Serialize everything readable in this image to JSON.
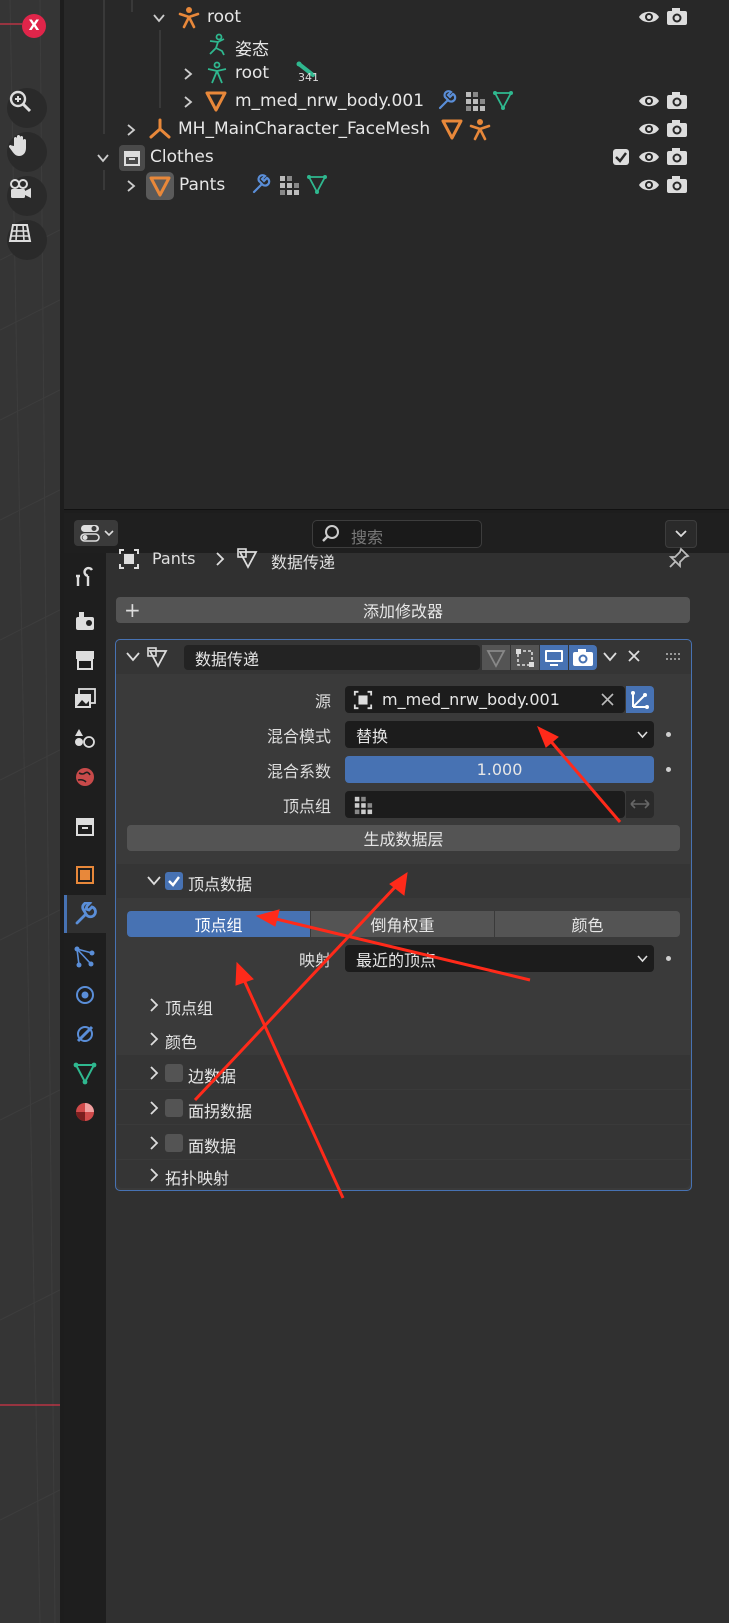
{
  "viewport": {
    "close_label": "X",
    "nav_icons": [
      "zoom-icon",
      "hand-pan-icon",
      "camera-icon",
      "grid-icon"
    ]
  },
  "outliner": {
    "rows": [
      {
        "label": "root",
        "icon": "armature-icon"
      },
      {
        "label": "姿态",
        "icon": "pose-icon"
      },
      {
        "label": "root",
        "icon": "pose-bone-icon",
        "count": "341"
      },
      {
        "label": "m_med_nrw_body.001",
        "icon": "mesh-icon"
      },
      {
        "label": "MH_MainCharacter_FaceMesh",
        "icon": "armature-object-icon"
      },
      {
        "label": "Clothes",
        "icon": "collection-icon"
      },
      {
        "label": "Pants",
        "icon": "mesh-icon"
      }
    ]
  },
  "properties": {
    "search_placeholder": "搜索",
    "breadcrumb": {
      "object": "Pants",
      "modifier": "数据传递"
    },
    "add_modifier_label": "添加修改器",
    "modifier": {
      "name": "数据传递",
      "source_label": "源",
      "source_value": "m_med_nrw_body.001",
      "mix_mode_label": "混合模式",
      "mix_mode_value": "替换",
      "mix_factor_label": "混合系数",
      "mix_factor_value": "1.000",
      "vertex_group_label": "顶点组",
      "generate_layers_label": "生成数据层",
      "vertex_data_label": "顶点数据",
      "vertex_data_checked": true,
      "vertex_tabs": [
        "顶点组",
        "倒角权重",
        "颜色"
      ],
      "vertex_tab_active": "顶点组",
      "mapping_label": "映射",
      "mapping_value": "最近的顶点",
      "sub_vertex_group": "顶点组",
      "sub_color": "颜色",
      "edge_data_label": "边数据",
      "face_corner_label": "面拐数据",
      "face_data_label": "面数据",
      "topology_label": "拓扑映射"
    }
  },
  "colors": {
    "accent_blue": "#4772b3",
    "arrow_red": "#ff2a1a",
    "mesh_orange": "#e8883a",
    "vertex_green": "#2fb88f"
  }
}
